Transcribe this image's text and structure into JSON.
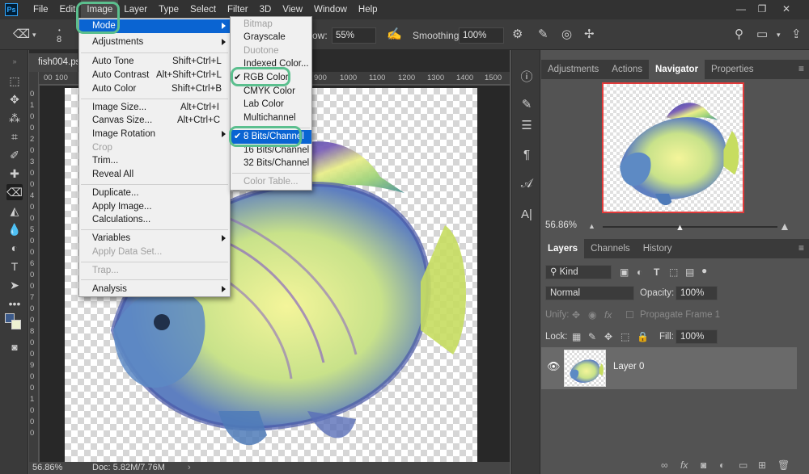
{
  "menubar": {
    "logo": "Ps",
    "items": [
      "File",
      "Edit",
      "Image",
      "Layer",
      "Type",
      "Select",
      "Filter",
      "3D",
      "View",
      "Window",
      "Help"
    ],
    "window_controls": [
      "—",
      "❐",
      "✕"
    ]
  },
  "options_bar": {
    "brush_size": "8",
    "flow_label": "ow:",
    "flow_value": "55%",
    "smoothing_label": "Smoothing:",
    "smoothing_value": "100%"
  },
  "document": {
    "tab_title": "fish004.ps",
    "zoom": "56.86%",
    "doc_info": "Doc: 5.82M/7.76M",
    "ruler_top": [
      "00",
      "100",
      "900",
      "1000",
      "1100",
      "1200",
      "1300",
      "1400",
      "1500"
    ],
    "ruler_left": [
      "0",
      "1",
      "0",
      "0",
      "2",
      "0",
      "3",
      "0",
      "0",
      "4",
      "0",
      "0",
      "5",
      "0",
      "0",
      "6",
      "0",
      "0",
      "7",
      "0",
      "0",
      "8",
      "0",
      "0",
      "9",
      "0",
      "0",
      "1",
      "0",
      "0",
      "0"
    ]
  },
  "image_menu": {
    "items": [
      {
        "label": "Mode",
        "submenu": true,
        "highlighted": true
      },
      {
        "label": "Adjustments",
        "submenu": true
      },
      {
        "label": "Auto Tone",
        "shortcut": "Shift+Ctrl+L"
      },
      {
        "label": "Auto Contrast",
        "shortcut": "Alt+Shift+Ctrl+L"
      },
      {
        "label": "Auto Color",
        "shortcut": "Shift+Ctrl+B"
      },
      {
        "label": "Image Size...",
        "shortcut": "Alt+Ctrl+I"
      },
      {
        "label": "Canvas Size...",
        "shortcut": "Alt+Ctrl+C"
      },
      {
        "label": "Image Rotation",
        "submenu": true
      },
      {
        "label": "Crop",
        "disabled": true
      },
      {
        "label": "Trim..."
      },
      {
        "label": "Reveal All"
      },
      {
        "label": "Duplicate..."
      },
      {
        "label": "Apply Image..."
      },
      {
        "label": "Calculations..."
      },
      {
        "label": "Variables",
        "submenu": true
      },
      {
        "label": "Apply Data Set...",
        "disabled": true
      },
      {
        "label": "Trap...",
        "disabled": true
      },
      {
        "label": "Analysis",
        "submenu": true
      }
    ]
  },
  "mode_menu": {
    "items": [
      {
        "label": "Bitmap",
        "disabled": true
      },
      {
        "label": "Grayscale"
      },
      {
        "label": "Duotone",
        "disabled": true
      },
      {
        "label": "Indexed Color..."
      },
      {
        "label": "RGB Color",
        "checked": true
      },
      {
        "label": "CMYK Color"
      },
      {
        "label": "Lab Color"
      },
      {
        "label": "Multichannel"
      },
      {
        "label": "8 Bits/Channel",
        "checked": true,
        "highlighted": true
      },
      {
        "label": "16 Bits/Channel"
      },
      {
        "label": "32 Bits/Channel"
      },
      {
        "label": "Color Table...",
        "disabled": true
      }
    ]
  },
  "top_panel": {
    "tabs": [
      "Adjustments",
      "Actions",
      "Navigator",
      "Properties"
    ],
    "active_tab": "Navigator",
    "zoom": "56.86%"
  },
  "layers_panel": {
    "tabs": [
      "Layers",
      "Channels",
      "History"
    ],
    "active_tab": "Layers",
    "filter_kind": "Kind",
    "blend_mode": "Normal",
    "opacity_label": "Opacity:",
    "opacity_value": "100%",
    "unify_label": "Unify:",
    "propagate_label": "Propagate Frame 1",
    "lock_label": "Lock:",
    "fill_label": "Fill:",
    "fill_value": "100%",
    "layer_name": "Layer 0"
  },
  "colors": {
    "highlight": "#0a64d2",
    "callout_ring": "#5bbf8e",
    "navigator_frame": "#e23b3b"
  }
}
